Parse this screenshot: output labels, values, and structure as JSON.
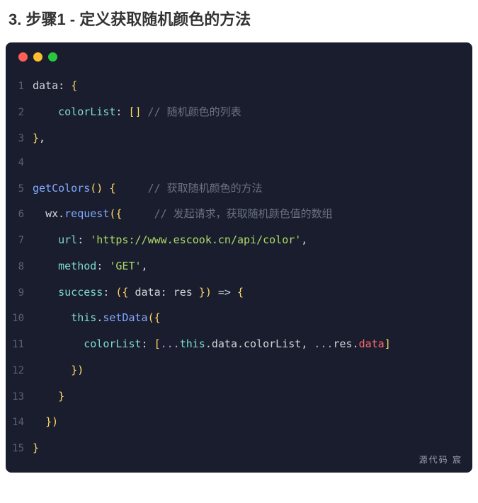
{
  "heading": "3. 步骤1 - 定义获取随机颜色的方法",
  "editor": {
    "dots": {
      "red": "#ff5f56",
      "yellow": "#ffbd2e",
      "green": "#27c93f"
    },
    "watermark": "源代码  宸",
    "lines": [
      {
        "num": "1",
        "segs": [
          {
            "cls": "tok-key",
            "t": "data"
          },
          {
            "cls": "tok-punct",
            "t": ": "
          },
          {
            "cls": "tok-bracket",
            "t": "{"
          }
        ]
      },
      {
        "num": "2",
        "segs": [
          {
            "cls": "",
            "t": "    "
          },
          {
            "cls": "tok-prop",
            "t": "colorList"
          },
          {
            "cls": "tok-punct",
            "t": ": "
          },
          {
            "cls": "tok-bracket",
            "t": "[]"
          },
          {
            "cls": "tok-comment",
            "t": " // 随机颜色的列表"
          }
        ]
      },
      {
        "num": "3",
        "segs": [
          {
            "cls": "tok-bracket",
            "t": "}"
          },
          {
            "cls": "tok-punct",
            "t": ","
          }
        ]
      },
      {
        "num": "4",
        "segs": []
      },
      {
        "num": "5",
        "segs": [
          {
            "cls": "tok-ident",
            "t": "getColors"
          },
          {
            "cls": "tok-bracket",
            "t": "()"
          },
          {
            "cls": "tok-punct",
            "t": " "
          },
          {
            "cls": "tok-bracket",
            "t": "{"
          },
          {
            "cls": "tok-comment",
            "t": "     // 获取随机颜色的方法"
          }
        ]
      },
      {
        "num": "6",
        "segs": [
          {
            "cls": "",
            "t": "  "
          },
          {
            "cls": "tok-obj",
            "t": "wx"
          },
          {
            "cls": "tok-punct",
            "t": "."
          },
          {
            "cls": "tok-method",
            "t": "request"
          },
          {
            "cls": "tok-bracket",
            "t": "({"
          },
          {
            "cls": "tok-comment",
            "t": "     // 发起请求，获取随机颜色值的数组"
          }
        ]
      },
      {
        "num": "7",
        "segs": [
          {
            "cls": "",
            "t": "    "
          },
          {
            "cls": "tok-prop",
            "t": "url"
          },
          {
            "cls": "tok-punct",
            "t": ": "
          },
          {
            "cls": "tok-string",
            "t": "'https://www.escook.cn/api/color'"
          },
          {
            "cls": "tok-punct",
            "t": ","
          }
        ]
      },
      {
        "num": "8",
        "segs": [
          {
            "cls": "",
            "t": "    "
          },
          {
            "cls": "tok-prop",
            "t": "method"
          },
          {
            "cls": "tok-punct",
            "t": ": "
          },
          {
            "cls": "tok-string",
            "t": "'GET'"
          },
          {
            "cls": "tok-punct",
            "t": ","
          }
        ]
      },
      {
        "num": "9",
        "segs": [
          {
            "cls": "",
            "t": "    "
          },
          {
            "cls": "tok-prop",
            "t": "success"
          },
          {
            "cls": "tok-punct",
            "t": ": "
          },
          {
            "cls": "tok-bracket",
            "t": "({ "
          },
          {
            "cls": "tok-key",
            "t": "data"
          },
          {
            "cls": "tok-punct",
            "t": ": "
          },
          {
            "cls": "tok-key",
            "t": "res"
          },
          {
            "cls": "tok-bracket",
            "t": " })"
          },
          {
            "cls": "tok-punct",
            "t": " => "
          },
          {
            "cls": "tok-bracket",
            "t": "{"
          }
        ]
      },
      {
        "num": "10",
        "segs": [
          {
            "cls": "",
            "t": "      "
          },
          {
            "cls": "tok-this",
            "t": "this"
          },
          {
            "cls": "tok-punct",
            "t": "."
          },
          {
            "cls": "tok-method",
            "t": "setData"
          },
          {
            "cls": "tok-bracket",
            "t": "({"
          }
        ]
      },
      {
        "num": "11",
        "segs": [
          {
            "cls": "",
            "t": "        "
          },
          {
            "cls": "tok-prop",
            "t": "colorList"
          },
          {
            "cls": "tok-punct",
            "t": ": "
          },
          {
            "cls": "tok-bracket",
            "t": "["
          },
          {
            "cls": "tok-spread",
            "t": "..."
          },
          {
            "cls": "tok-this",
            "t": "this"
          },
          {
            "cls": "tok-punct",
            "t": "."
          },
          {
            "cls": "tok-key",
            "t": "data"
          },
          {
            "cls": "tok-punct",
            "t": "."
          },
          {
            "cls": "tok-key",
            "t": "colorList"
          },
          {
            "cls": "tok-punct",
            "t": ", "
          },
          {
            "cls": "tok-spread",
            "t": "..."
          },
          {
            "cls": "tok-key",
            "t": "res"
          },
          {
            "cls": "tok-punct",
            "t": "."
          },
          {
            "cls": "tok-res",
            "t": "data"
          },
          {
            "cls": "tok-bracket",
            "t": "]"
          }
        ]
      },
      {
        "num": "12",
        "segs": [
          {
            "cls": "",
            "t": "      "
          },
          {
            "cls": "tok-bracket",
            "t": "})"
          }
        ]
      },
      {
        "num": "13",
        "segs": [
          {
            "cls": "",
            "t": "    "
          },
          {
            "cls": "tok-bracket",
            "t": "}"
          }
        ]
      },
      {
        "num": "14",
        "segs": [
          {
            "cls": "",
            "t": "  "
          },
          {
            "cls": "tok-bracket",
            "t": "})"
          }
        ]
      },
      {
        "num": "15",
        "segs": [
          {
            "cls": "tok-bracket",
            "t": "}"
          }
        ]
      }
    ]
  }
}
